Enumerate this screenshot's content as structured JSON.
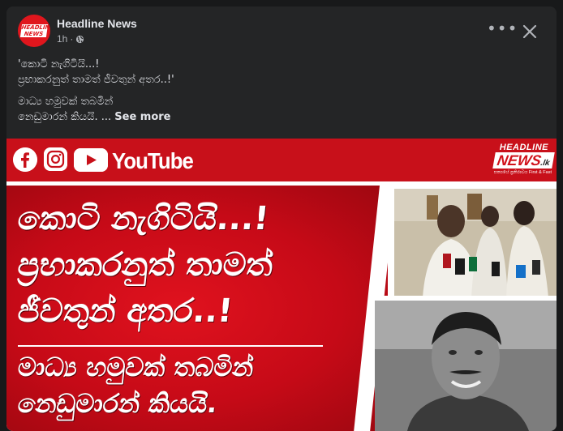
{
  "post": {
    "page_name": "Headline News",
    "time": "1h",
    "separator": "·",
    "more_label": "•••",
    "avatar_text": "HEADLINE NEWS",
    "lines": [
      "'කොටි නැගිටියි...!",
      "ප්‍රභාකරනුත් තාමත් ජීවතුන් අතර..!'",
      "මාධ්‍ය හමුවක් තබමින්",
      "නෙඩුමාරන් කියයි. ..."
    ],
    "see_more": "See more"
  },
  "image": {
    "youtube_label": "YouTube",
    "logo_line1": "HEADLINE",
    "logo_line2": "NEWS",
    "logo_domain": ".lk",
    "logo_tagline": "සත්‍යයේ ප්‍රතිරාවය First & Fast",
    "headline_1": "කොටි නැගිටියි...!",
    "headline_2": "ප්‍රභාකරනුත් තාමත්",
    "headline_3": "ජීවතුන් අතර..!",
    "headline_4": "මාධ්‍ය හමුවක් තබමින්",
    "headline_5": "නෙඩුමාරන් කියයි."
  },
  "colors": {
    "card_bg": "#242526",
    "brand_red": "#c8101a",
    "text_primary": "#e4e6eb",
    "text_secondary": "#b0b3b8"
  },
  "icons": [
    "globe-icon",
    "more-icon",
    "close-icon",
    "facebook-icon",
    "instagram-icon",
    "youtube-icon"
  ]
}
